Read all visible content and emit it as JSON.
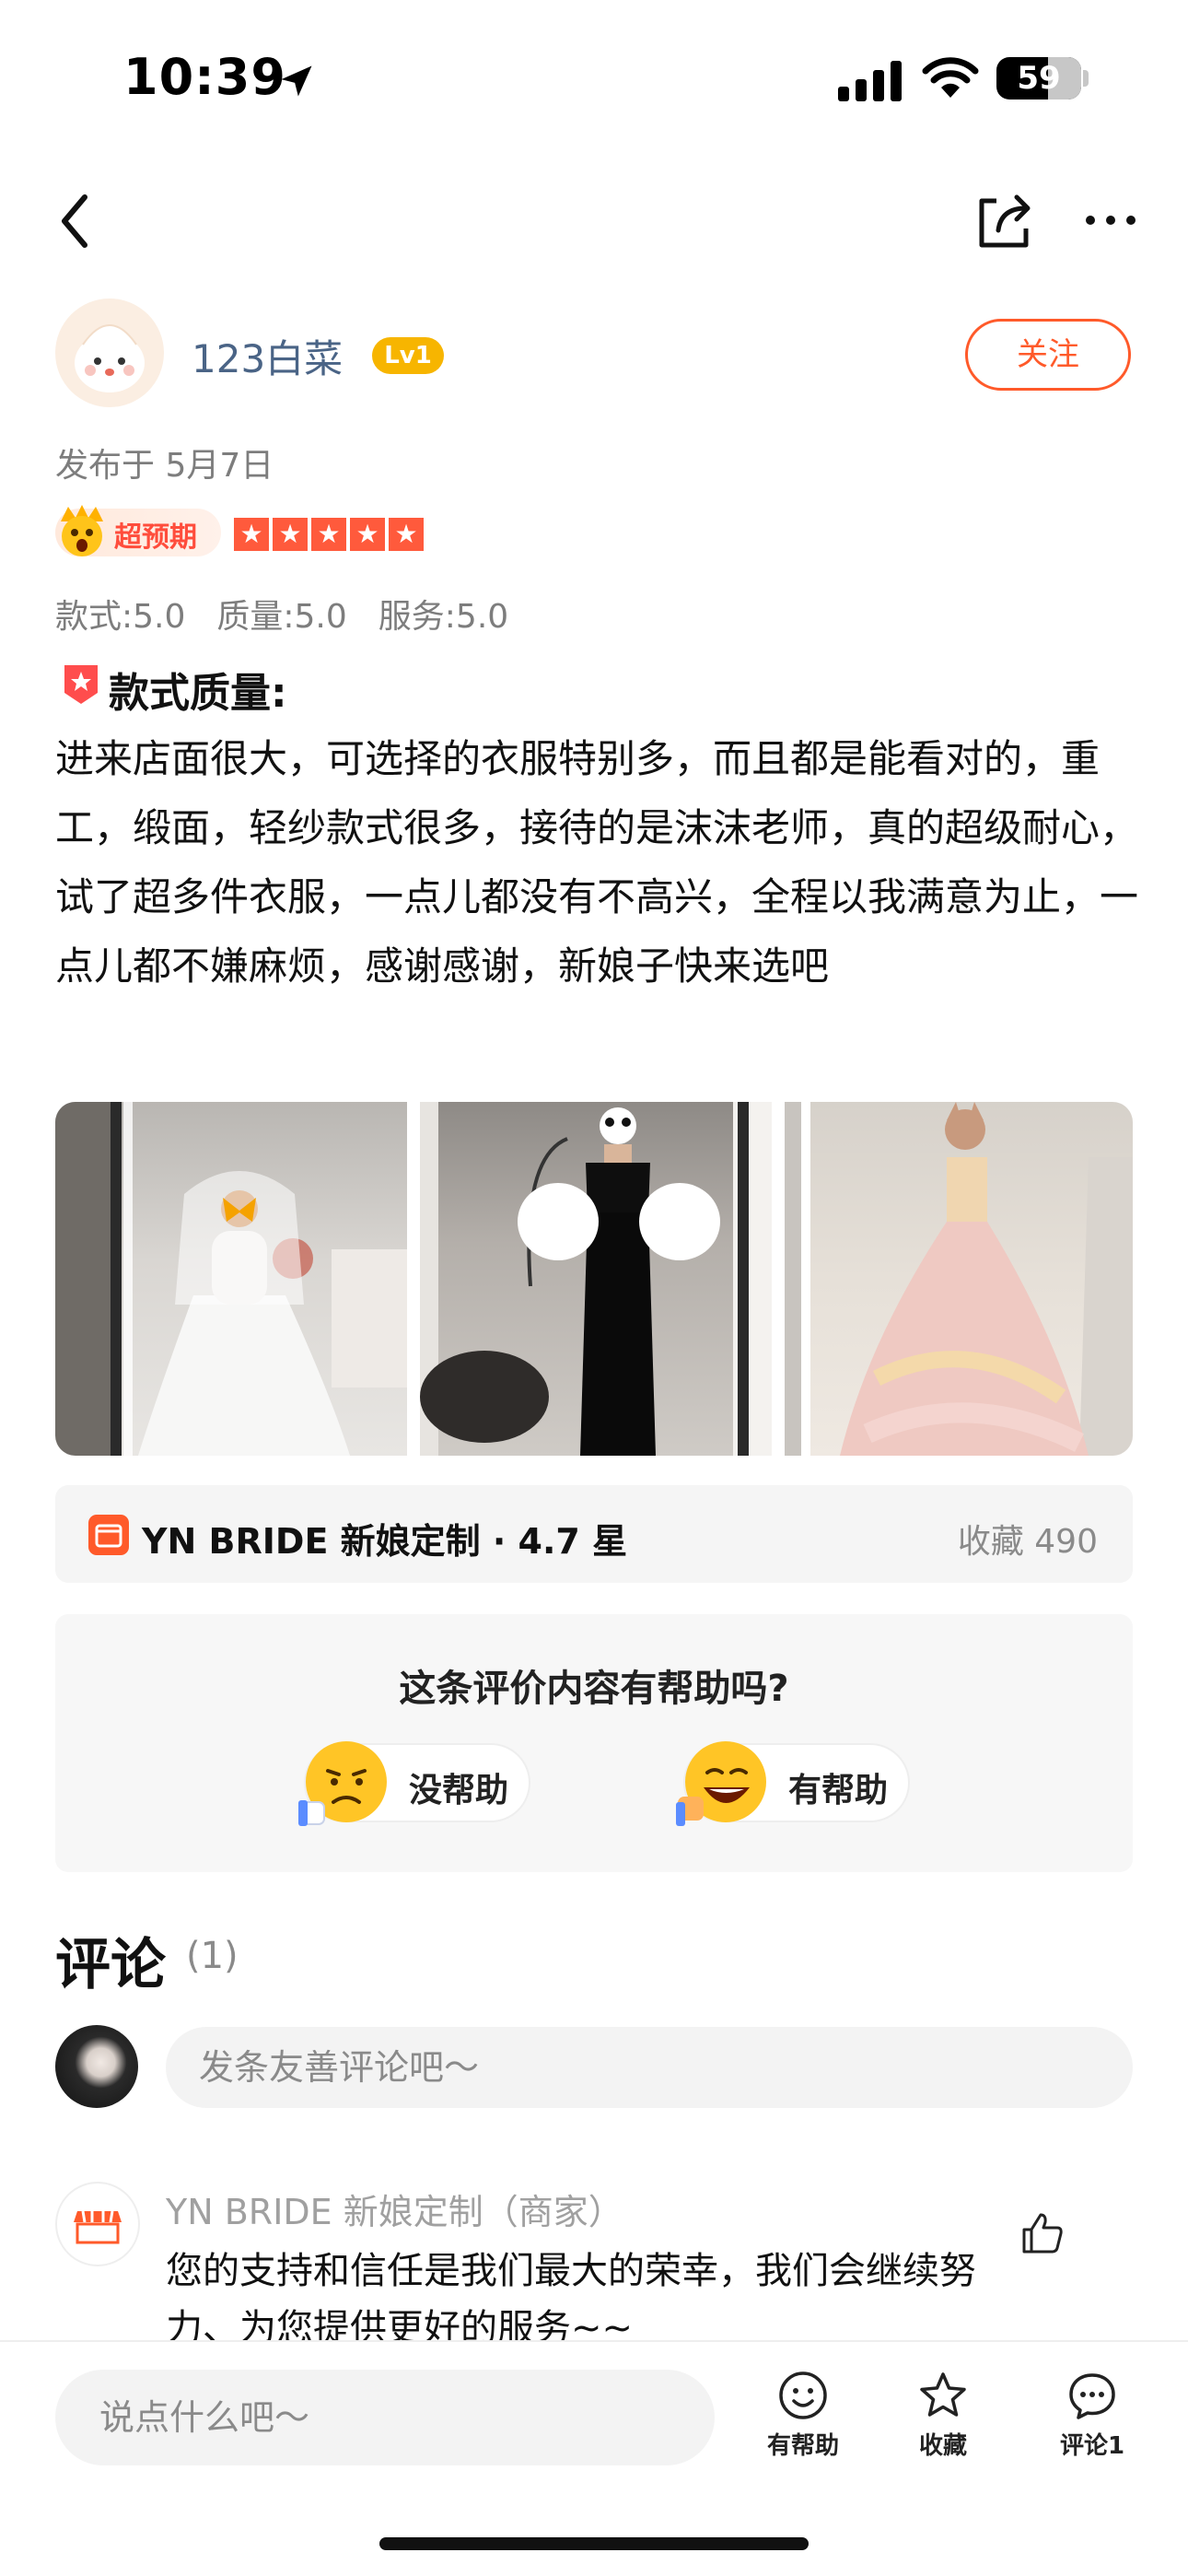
{
  "status_bar": {
    "time": "10:39",
    "battery": "59"
  },
  "user": {
    "name": "123白菜",
    "level": "Lv1",
    "follow_label": "关注"
  },
  "post": {
    "publish_date": "发布于 5月7日",
    "badge": "超预期",
    "rating_stars": 5,
    "scores": [
      "款式:5.0",
      "质量:5.0",
      "服务:5.0"
    ],
    "review_title": "款式质量:",
    "review_body": "进来店面很大，可选择的衣服特别多，而且都是能看对的，重工，缎面，轻纱款式很多，接待的是沫沫老师，真的超级耐心，试了超多件衣服，一点儿都没有不高兴，全程以我满意为止，一点儿都不嫌麻烦，感谢感谢，新娘子快来选吧"
  },
  "shop": {
    "name": "YN BRIDE 新娘定制 · 4.7 星",
    "favorites": "收藏 490"
  },
  "helpful": {
    "question": "这条评价内容有帮助吗?",
    "not_helpful_label": "没帮助",
    "helpful_label": "有帮助"
  },
  "comments": {
    "title": "评论",
    "count": "(1)",
    "input_placeholder": "发条友善评论吧～",
    "items": [
      {
        "author": "YN BRIDE 新娘定制（商家）",
        "text": "您的支持和信任是我们最大的荣幸，我们会继续努力、为您提供更好的服务~~"
      }
    ]
  },
  "bottom_bar": {
    "input_placeholder": "说点什么吧～",
    "helpful_label": "有帮助",
    "favorite_label": "收藏",
    "comment_label": "评论1"
  },
  "colors": {
    "accent": "#ff5a2a",
    "username": "#4a6486",
    "level_badge": "#f7b500"
  },
  "icons": [
    "back-icon",
    "share-icon",
    "more-icon",
    "shop-icon",
    "thumbs-up-icon",
    "smile-icon",
    "star-icon",
    "comment-icon"
  ]
}
